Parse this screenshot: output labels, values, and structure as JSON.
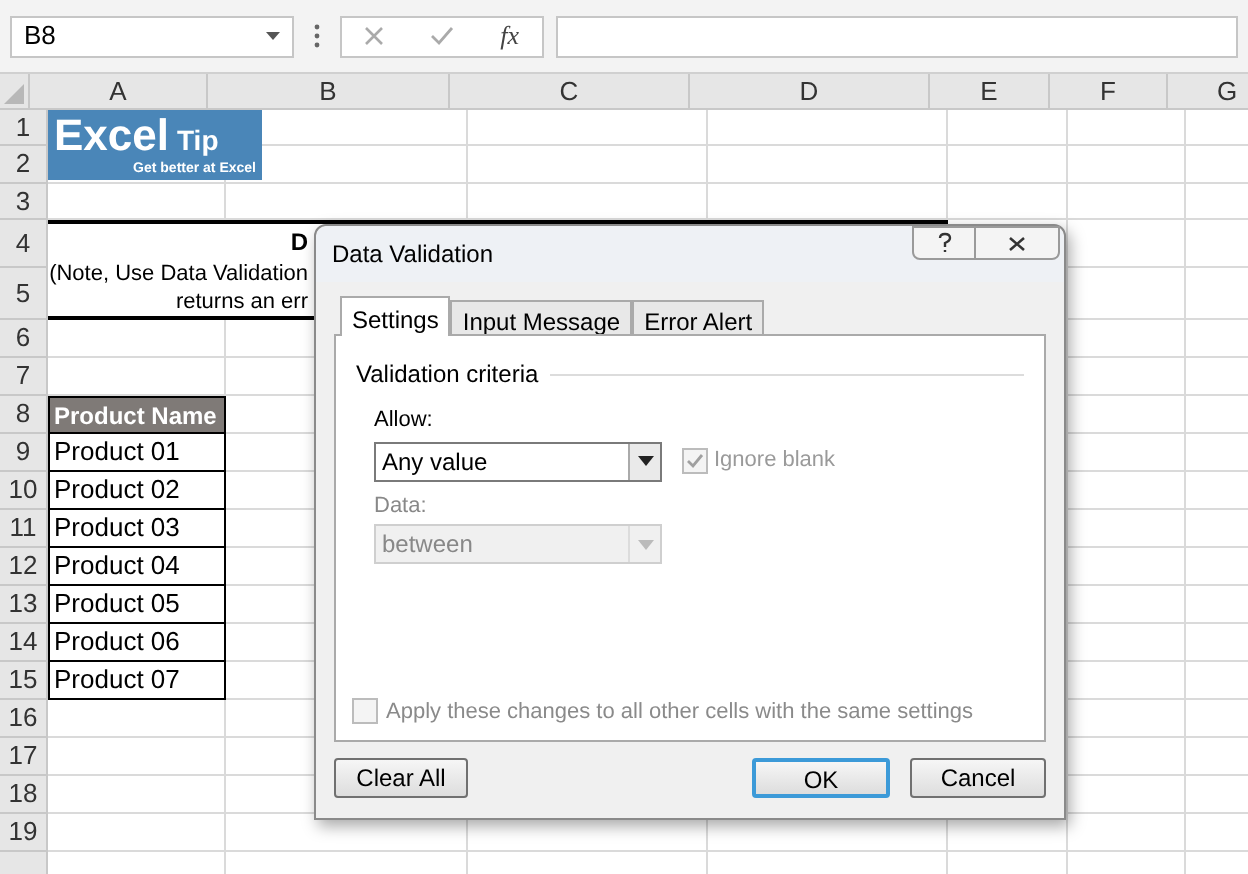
{
  "formula_bar": {
    "name_box": "B8",
    "function_label": "fx"
  },
  "columns": [
    "A",
    "B",
    "C",
    "D",
    "E",
    "F",
    "G"
  ],
  "row_numbers": [
    "1",
    "2",
    "3",
    "4",
    "5",
    "6",
    "7",
    "8",
    "9",
    "10",
    "11",
    "12",
    "13",
    "14",
    "15",
    "16",
    "17",
    "18",
    "19"
  ],
  "logo": {
    "word_1": "Excel",
    "word_2": "Tip",
    "tagline": "Get better at Excel"
  },
  "heading": {
    "title": "D",
    "note_line_1": "(Note, Use Data Validation",
    "note_line_2": "returns an err"
  },
  "table": {
    "header": "Product Name",
    "cells": [
      "Product 01",
      "Product 02",
      "Product 03",
      "Product 04",
      "Product 05",
      "Product 06",
      "Product 07"
    ]
  },
  "dialog": {
    "title": "Data Validation",
    "tabs": [
      {
        "label": "Settings",
        "selected": true
      },
      {
        "label": "Input Message",
        "selected": false
      },
      {
        "label": "Error Alert",
        "selected": false
      }
    ],
    "group_title": "Validation criteria",
    "allow": {
      "label": "Allow:",
      "value": "Any value",
      "disabled": false
    },
    "ignore_blank": {
      "label": "Ignore blank",
      "checked": true,
      "disabled": true
    },
    "data": {
      "label": "Data:",
      "value": "between",
      "disabled": true
    },
    "apply_all": {
      "label": "Apply these changes to all other cells with the same settings",
      "checked": false,
      "disabled": true
    },
    "buttons": [
      {
        "label": "Clear All",
        "kind": "left"
      },
      {
        "label": "OK",
        "kind": "default"
      },
      {
        "label": "Cancel",
        "kind": "right"
      }
    ]
  }
}
